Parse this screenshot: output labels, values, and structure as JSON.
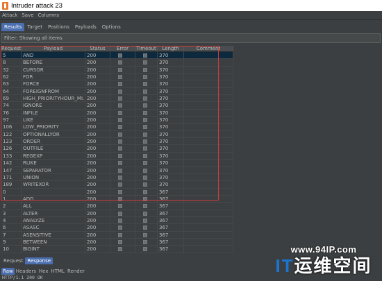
{
  "window": {
    "title": "Intruder attack 23"
  },
  "menu": [
    "Attack",
    "Save",
    "Columns"
  ],
  "tabs": [
    {
      "label": "Results",
      "active": true
    },
    {
      "label": "Target",
      "active": false
    },
    {
      "label": "Positions",
      "active": false
    },
    {
      "label": "Payloads",
      "active": false
    },
    {
      "label": "Options",
      "active": false
    }
  ],
  "filter": {
    "text": "Filter: Showing all items"
  },
  "table": {
    "columns": [
      "Request",
      "Payload",
      "Status",
      "Error",
      "Timeout",
      "Length",
      "Comment"
    ],
    "rows": [
      {
        "req": "5",
        "payload": "AND",
        "status": "200",
        "length": "370",
        "selected": true
      },
      {
        "req": "8",
        "payload": "BEFORE",
        "status": "200",
        "length": "370"
      },
      {
        "req": "32",
        "payload": "CURSOR",
        "status": "200",
        "length": "370"
      },
      {
        "req": "62",
        "payload": "FOR",
        "status": "200",
        "length": "370"
      },
      {
        "req": "63",
        "payload": "FORCE",
        "status": "200",
        "length": "370"
      },
      {
        "req": "64",
        "payload": "FOREIGNFROM",
        "status": "200",
        "length": "370"
      },
      {
        "req": "69",
        "payload": "HIGH_PRIORITYHOUR_MI...",
        "status": "200",
        "length": "370"
      },
      {
        "req": "74",
        "payload": "IGNORE",
        "status": "200",
        "length": "370"
      },
      {
        "req": "76",
        "payload": "INFILE",
        "status": "200",
        "length": "370"
      },
      {
        "req": "97",
        "payload": "LIKE",
        "status": "200",
        "length": "370"
      },
      {
        "req": "106",
        "payload": "LOW_PRIORITY",
        "status": "200",
        "length": "370"
      },
      {
        "req": "122",
        "payload": "OPTIONALLYOR",
        "status": "200",
        "length": "370"
      },
      {
        "req": "123",
        "payload": "ORDER",
        "status": "200",
        "length": "370"
      },
      {
        "req": "126",
        "payload": "OUTFILE",
        "status": "200",
        "length": "370"
      },
      {
        "req": "133",
        "payload": "REGEXP",
        "status": "200",
        "length": "370"
      },
      {
        "req": "142",
        "payload": "RLIKE",
        "status": "200",
        "length": "370"
      },
      {
        "req": "147",
        "payload": "SEPARATOR",
        "status": "200",
        "length": "370"
      },
      {
        "req": "171",
        "payload": "UNION",
        "status": "200",
        "length": "370"
      },
      {
        "req": "189",
        "payload": "WRITEXOR",
        "status": "200",
        "length": "370"
      },
      {
        "req": "0",
        "payload": "",
        "status": "200",
        "length": "367"
      },
      {
        "req": "1",
        "payload": "ADD",
        "status": "200",
        "length": "367"
      },
      {
        "req": "2",
        "payload": "ALL",
        "status": "200",
        "length": "367"
      },
      {
        "req": "3",
        "payload": "ALTER",
        "status": "200",
        "length": "367"
      },
      {
        "req": "4",
        "payload": "ANALYZE",
        "status": "200",
        "length": "367"
      },
      {
        "req": "6",
        "payload": "ASASC",
        "status": "200",
        "length": "367"
      },
      {
        "req": "7",
        "payload": "ASENSITIVE",
        "status": "200",
        "length": "367"
      },
      {
        "req": "9",
        "payload": "BETWEEN",
        "status": "200",
        "length": "367"
      },
      {
        "req": "10",
        "payload": "BIGINT",
        "status": "200",
        "length": "367"
      }
    ]
  },
  "bottom_tabs": [
    {
      "label": "Request",
      "active": false
    },
    {
      "label": "Response",
      "active": true
    }
  ],
  "sub_tabs": [
    {
      "label": "Raw",
      "active": true
    },
    {
      "label": "Headers",
      "active": false
    },
    {
      "label": "Hex",
      "active": false
    },
    {
      "label": "HTML",
      "active": false
    },
    {
      "label": "Render",
      "active": false
    }
  ],
  "response_line": "HTTP/1.1 200 OK",
  "watermark": {
    "url": "www.94IP.com",
    "brand_it": "IT",
    "brand_rest": "运维空间"
  },
  "colors": {
    "accent": "#4b6eaf",
    "selected_row": "#0d293e",
    "highlight_box": "#d23c3c",
    "watermark_blue": "#1a75d2"
  }
}
